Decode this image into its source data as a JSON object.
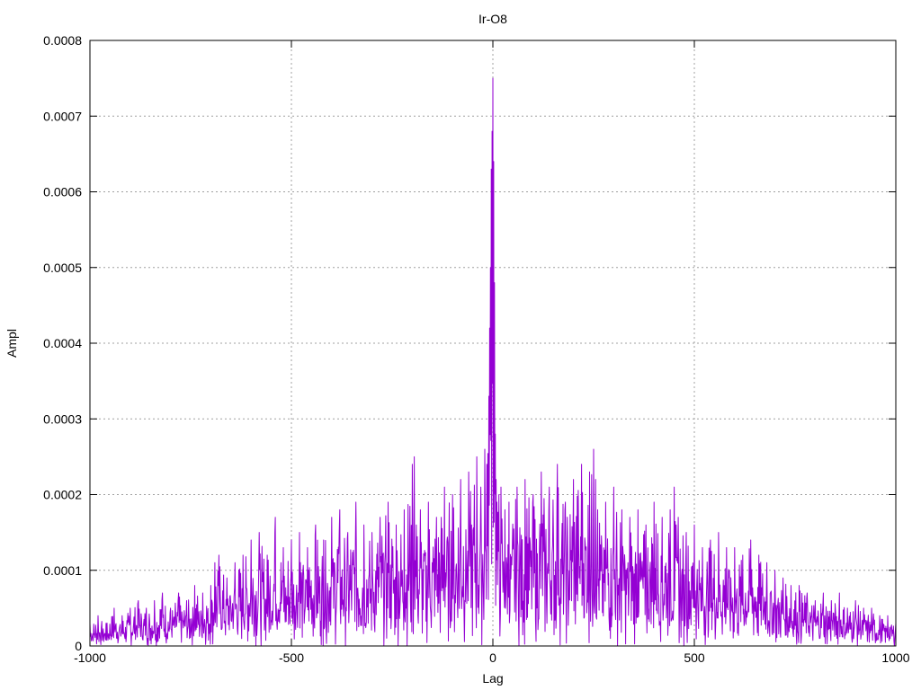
{
  "chart_data": {
    "type": "line",
    "title": "Ir-O8",
    "xlabel": "Lag",
    "ylabel": "Ampl",
    "xlim": [
      -1000,
      1000
    ],
    "ylim": [
      0,
      0.0008
    ],
    "x_ticks": [
      -1000,
      -500,
      0,
      500,
      1000
    ],
    "x_tick_labels": [
      "-1000",
      "-500",
      "0",
      "500",
      "1000"
    ],
    "y_ticks": [
      0,
      0.0001,
      0.0002,
      0.0003,
      0.0004,
      0.0005,
      0.0006,
      0.0007,
      0.0008
    ],
    "y_tick_labels": [
      "0",
      "0.0001",
      "0.0002",
      "0.0003",
      "0.0004",
      "0.0005",
      "0.0006",
      "0.0007",
      "0.0008"
    ],
    "grid": true,
    "line_color": "#9400d3",
    "series": [
      {
        "x": [
          -1000,
          -980,
          -960,
          -940,
          -920,
          -900,
          -880,
          -860,
          -840,
          -820,
          -800,
          -780,
          -760,
          -740,
          -720,
          -700,
          -690,
          -680,
          -660,
          -640,
          -620,
          -600,
          -580,
          -560,
          -540,
          -520,
          -500,
          -480,
          -460,
          -440,
          -420,
          -400,
          -380,
          -360,
          -340,
          -320,
          -300,
          -280,
          -260,
          -240,
          -220,
          -200,
          -195,
          -190,
          -180,
          -160,
          -140,
          -120,
          -100,
          -80,
          -60,
          -40,
          -30,
          -20,
          -15,
          -10,
          -8,
          -6,
          -4,
          -2,
          0,
          2,
          4,
          6,
          8,
          10,
          15,
          20,
          30,
          40,
          60,
          80,
          100,
          120,
          140,
          160,
          180,
          200,
          220,
          240,
          250,
          255,
          260,
          280,
          300,
          320,
          340,
          360,
          380,
          400,
          420,
          440,
          450,
          455,
          460,
          480,
          500,
          520,
          540,
          560,
          580,
          600,
          620,
          640,
          660,
          680,
          700,
          720,
          740,
          760,
          780,
          800,
          820,
          840,
          860,
          880,
          900,
          920,
          940,
          960,
          980,
          1000
        ],
        "y": [
          3e-05,
          4e-05,
          3e-05,
          5e-05,
          4e-05,
          5e-05,
          6e-05,
          5e-05,
          6e-05,
          7e-05,
          5e-05,
          7e-05,
          6e-05,
          8e-05,
          7e-05,
          8e-05,
          0.00011,
          0.00012,
          9e-05,
          0.00011,
          0.00012,
          0.00014,
          0.00015,
          0.00012,
          0.00017,
          0.00013,
          0.00014,
          0.00015,
          0.00013,
          0.00016,
          0.00014,
          0.00017,
          0.00018,
          0.00015,
          0.00019,
          0.00016,
          0.00015,
          0.00017,
          0.00019,
          0.00016,
          0.00018,
          0.00024,
          0.00025,
          0.00016,
          0.00018,
          0.00019,
          0.00017,
          0.00021,
          0.0002,
          0.00022,
          0.00023,
          0.00025,
          0.00021,
          0.00026,
          0.00024,
          0.00033,
          0.00042,
          0.0005,
          0.00063,
          0.00068,
          0.00075,
          0.00064,
          0.00048,
          0.00028,
          0.00022,
          0.00019,
          0.0002,
          0.00021,
          0.00018,
          0.00019,
          0.00021,
          0.00022,
          0.0002,
          0.00023,
          0.00021,
          0.00024,
          0.00019,
          0.00022,
          0.00024,
          0.00023,
          0.00026,
          0.00022,
          0.00018,
          0.00019,
          0.00021,
          0.00018,
          0.00017,
          0.00018,
          0.00016,
          0.00019,
          0.00017,
          0.00018,
          0.00021,
          0.00016,
          0.00017,
          0.00015,
          0.00016,
          0.00013,
          0.00014,
          0.00015,
          0.00013,
          0.00013,
          0.00012,
          0.00014,
          0.00012,
          0.00011,
          0.0001,
          9e-05,
          8e-05,
          8e-05,
          7e-05,
          6e-05,
          7e-05,
          6e-05,
          7e-05,
          5e-05,
          6e-05,
          5e-05,
          5e-05,
          4e-05,
          4e-05,
          3e-05
        ]
      }
    ]
  }
}
